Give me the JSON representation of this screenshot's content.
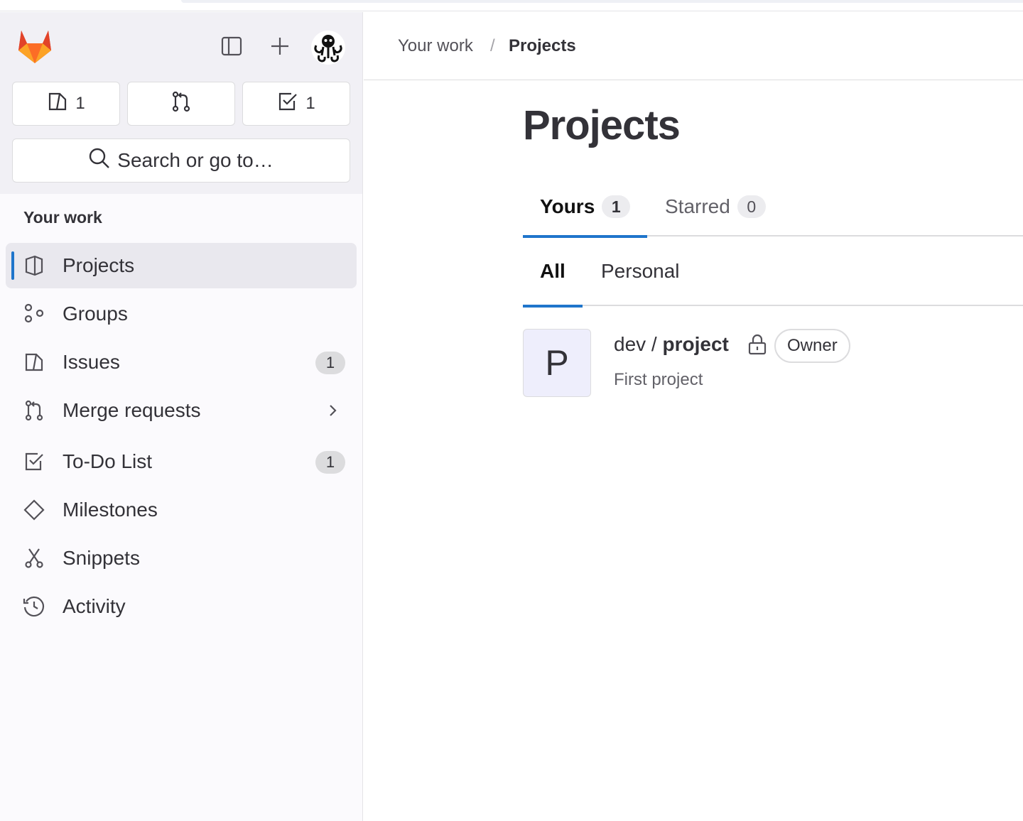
{
  "sidebar": {
    "header": {
      "logo_icon": "gitlab-tanuki-icon",
      "toggle_icon": "sidebar-toggle-icon",
      "create_icon": "plus-icon",
      "avatar_icon": "user-avatar"
    },
    "counts": [
      {
        "icon": "issues-icon",
        "count": "1"
      },
      {
        "icon": "merge-request-icon",
        "count": ""
      },
      {
        "icon": "todo-icon",
        "count": "1"
      }
    ],
    "search_placeholder": "Search or go to…",
    "section_title": "Your work",
    "items": [
      {
        "label": "Projects",
        "icon": "project-icon",
        "active": true
      },
      {
        "label": "Groups",
        "icon": "group-icon"
      },
      {
        "label": "Issues",
        "icon": "issues-icon",
        "badge": "1"
      },
      {
        "label": "Merge requests",
        "icon": "merge-request-icon",
        "chevron": true
      },
      {
        "label": "To-Do List",
        "icon": "todo-icon",
        "badge": "1"
      },
      {
        "label": "Milestones",
        "icon": "milestone-icon"
      },
      {
        "label": "Snippets",
        "icon": "snippet-icon"
      },
      {
        "label": "Activity",
        "icon": "history-icon"
      }
    ]
  },
  "breadcrumb": {
    "parent": "Your work",
    "separator": "/",
    "current": "Projects"
  },
  "page_title": "Projects",
  "tabs": [
    {
      "label": "Yours",
      "count": "1",
      "active": true
    },
    {
      "label": "Starred",
      "count": "0",
      "active": false
    }
  ],
  "subtabs": [
    {
      "label": "All",
      "active": true
    },
    {
      "label": "Personal",
      "active": false
    }
  ],
  "projects": [
    {
      "avatar_letter": "P",
      "namespace": "dev / ",
      "name": "project",
      "visibility_icon": "lock-icon",
      "role": "Owner",
      "description": "First project"
    }
  ],
  "colors": {
    "accent": "#1f75cb",
    "sidebar_bg": "#fbfafd",
    "sidebar_top_bg": "#f1f0f5",
    "active_item_bg": "#e9e8ee",
    "project_avatar_bg": "#eeeefc"
  }
}
